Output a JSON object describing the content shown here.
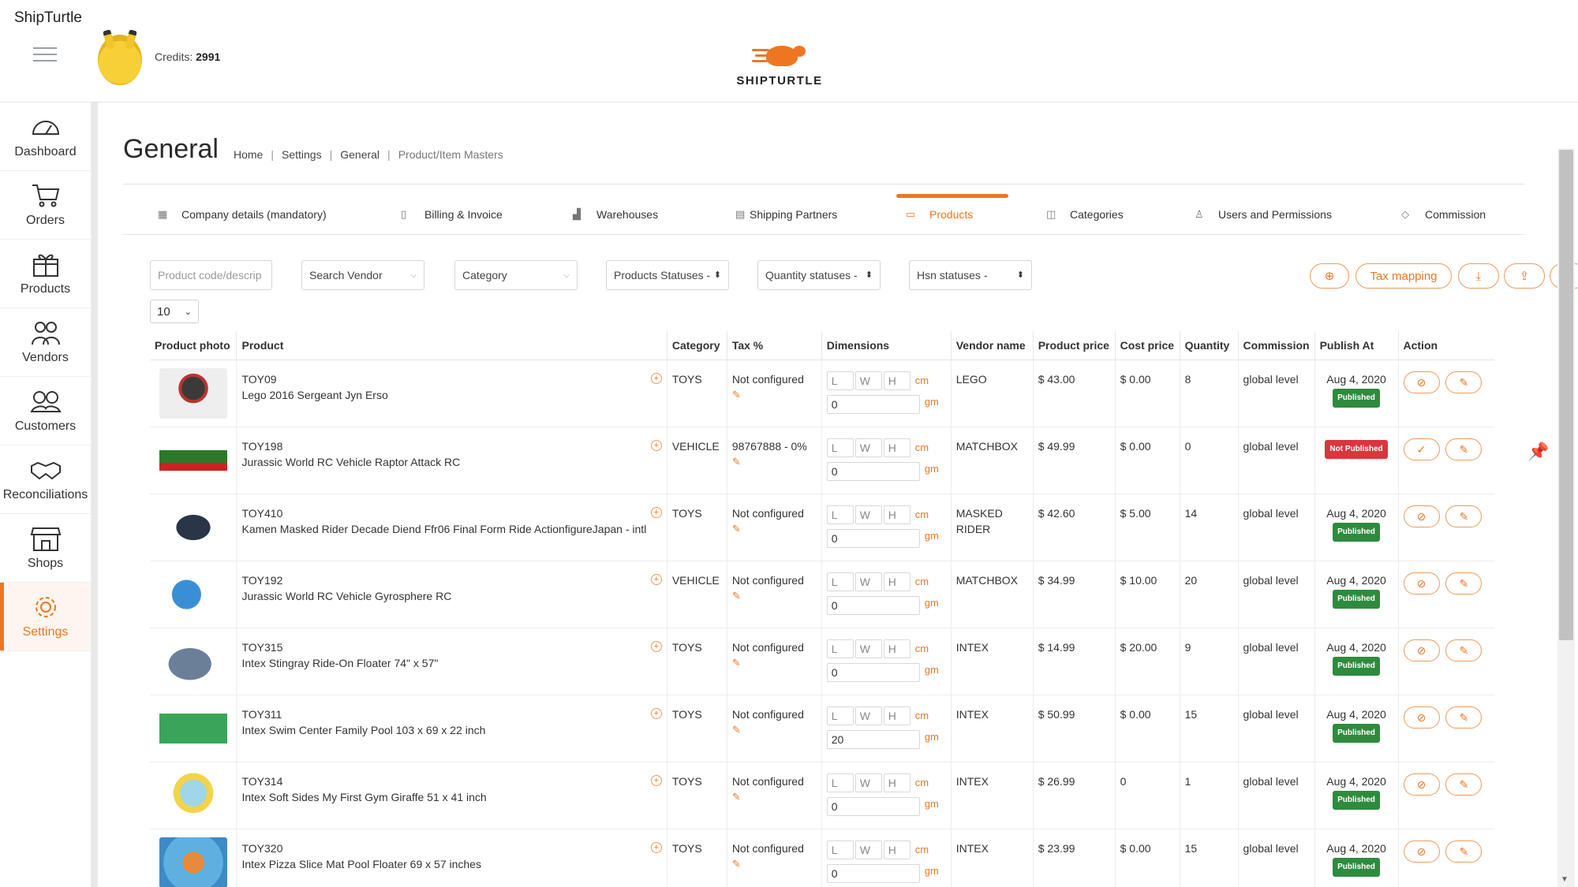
{
  "window": {
    "title": "ShipTurtle"
  },
  "header": {
    "credits_label": "Credits:",
    "credits_value": "2991",
    "brand": "SHIPTURTLE"
  },
  "sidebar": {
    "items": [
      {
        "label": "Dashboard",
        "icon": "speedometer-icon"
      },
      {
        "label": "Orders",
        "icon": "cart-icon"
      },
      {
        "label": "Products",
        "icon": "gift-box-icon"
      },
      {
        "label": "Vendors",
        "icon": "people-icon"
      },
      {
        "label": "Customers",
        "icon": "customers-icon"
      },
      {
        "label": "Reconciliations",
        "icon": "handshake-icon"
      },
      {
        "label": "Shops",
        "icon": "shop-icon"
      },
      {
        "label": "Settings",
        "icon": "gear-icon",
        "active": true
      }
    ]
  },
  "page": {
    "title": "General",
    "breadcrumb": [
      "Home",
      "Settings",
      "General",
      "Product/Item Masters"
    ]
  },
  "tabs": [
    {
      "label": "Company details (mandatory)",
      "icon": "building-icon"
    },
    {
      "label": "Billing & Invoice",
      "icon": "clipboard-icon"
    },
    {
      "label": "Warehouses",
      "icon": "warehouse-icon"
    },
    {
      "label": "Shipping Partners",
      "icon": "partner-icon"
    },
    {
      "label": "Products",
      "icon": "products-icon",
      "active": true
    },
    {
      "label": "Categories",
      "icon": "book-icon"
    },
    {
      "label": "Users and Permissions",
      "icon": "user-icon"
    },
    {
      "label": "Commission",
      "icon": "tag-icon"
    }
  ],
  "filters": {
    "search_placeholder": "Product code/descrip",
    "vendor": "Search Vendor",
    "category": "Category",
    "product_status": "Products Statuses -",
    "quantity_status": "Quantity statuses -",
    "hsn_status": "Hsn statuses -",
    "tax_mapping": "Tax mapping",
    "page_size": "10"
  },
  "table": {
    "headers": [
      "Product photo",
      "Product",
      "Category",
      "Tax %",
      "Dimensions",
      "Vendor name",
      "Product price",
      "Cost price",
      "Quantity",
      "Commission",
      "Publish At",
      "Action"
    ],
    "dim_labels": {
      "l": "L",
      "w": "W",
      "h": "H",
      "cm": "cm",
      "gm": "gm"
    },
    "rows": [
      {
        "code": "TOY09",
        "name": "Lego 2016 Sergeant Jyn Erso",
        "category": "TOYS",
        "tax": "Not configured",
        "weight": "0",
        "vendor": "LEGO",
        "price": "$ 43.00",
        "cost": "$ 0.00",
        "qty": "8",
        "commission": "global level",
        "publish_date": "Aug 4, 2020",
        "status": "Published"
      },
      {
        "code": "TOY198",
        "name": "Jurassic World RC Vehicle Raptor Attack RC",
        "category": "VEHICLE",
        "tax": "98767888 - 0%",
        "weight": "0",
        "vendor": "MATCHBOX",
        "price": "$ 49.99",
        "cost": "$ 0.00",
        "qty": "0",
        "commission": "global level",
        "publish_date": "",
        "status": "Not Published"
      },
      {
        "code": "TOY410",
        "name": "Kamen Masked Rider Decade Diend Ffr06 Final Form Ride ActionfigureJapan - intl",
        "category": "TOYS",
        "tax": "Not configured",
        "weight": "0",
        "vendor": "MASKED RIDER",
        "price": "$ 42.60",
        "cost": "$ 5.00",
        "qty": "14",
        "commission": "global level",
        "publish_date": "Aug 4, 2020",
        "status": "Published"
      },
      {
        "code": "TOY192",
        "name": "Jurassic World RC Vehicle Gyrosphere RC",
        "category": "VEHICLE",
        "tax": "Not configured",
        "weight": "0",
        "vendor": "MATCHBOX",
        "price": "$ 34.99",
        "cost": "$ 10.00",
        "qty": "20",
        "commission": "global level",
        "publish_date": "Aug 4, 2020",
        "status": "Published"
      },
      {
        "code": "TOY315",
        "name": "Intex Stingray Ride-On Floater 74\" x 57\"",
        "category": "TOYS",
        "tax": "Not configured",
        "weight": "0",
        "vendor": "INTEX",
        "price": "$ 14.99",
        "cost": "$ 20.00",
        "qty": "9",
        "commission": "global level",
        "publish_date": "Aug 4, 2020",
        "status": "Published"
      },
      {
        "code": "TOY311",
        "name": "Intex Swim Center Family Pool 103 x 69 x 22 inch",
        "category": "TOYS",
        "tax": "Not configured",
        "weight": "20",
        "vendor": "INTEX",
        "price": "$ 50.99",
        "cost": "$ 0.00",
        "qty": "15",
        "commission": "global level",
        "publish_date": "Aug 4, 2020",
        "status": "Published"
      },
      {
        "code": "TOY314",
        "name": "Intex Soft Sides My First Gym Giraffe 51 x 41 inch",
        "category": "TOYS",
        "tax": "Not configured",
        "weight": "0",
        "vendor": "INTEX",
        "price": "$ 26.99",
        "cost": "0",
        "qty": "1",
        "commission": "global level",
        "publish_date": "Aug 4, 2020",
        "status": "Published"
      },
      {
        "code": "TOY320",
        "name": "Intex Pizza Slice Mat Pool Floater 69 x 57 inches",
        "category": "TOYS",
        "tax": "Not configured",
        "weight": "0",
        "vendor": "INTEX",
        "price": "$ 23.99",
        "cost": "$ 0.00",
        "qty": "15",
        "commission": "global level",
        "publish_date": "Aug 4, 2020",
        "status": "Published"
      }
    ]
  },
  "colors": {
    "accent": "#ee7622",
    "published": "#2e8b3e",
    "not_published": "#d9363e"
  }
}
